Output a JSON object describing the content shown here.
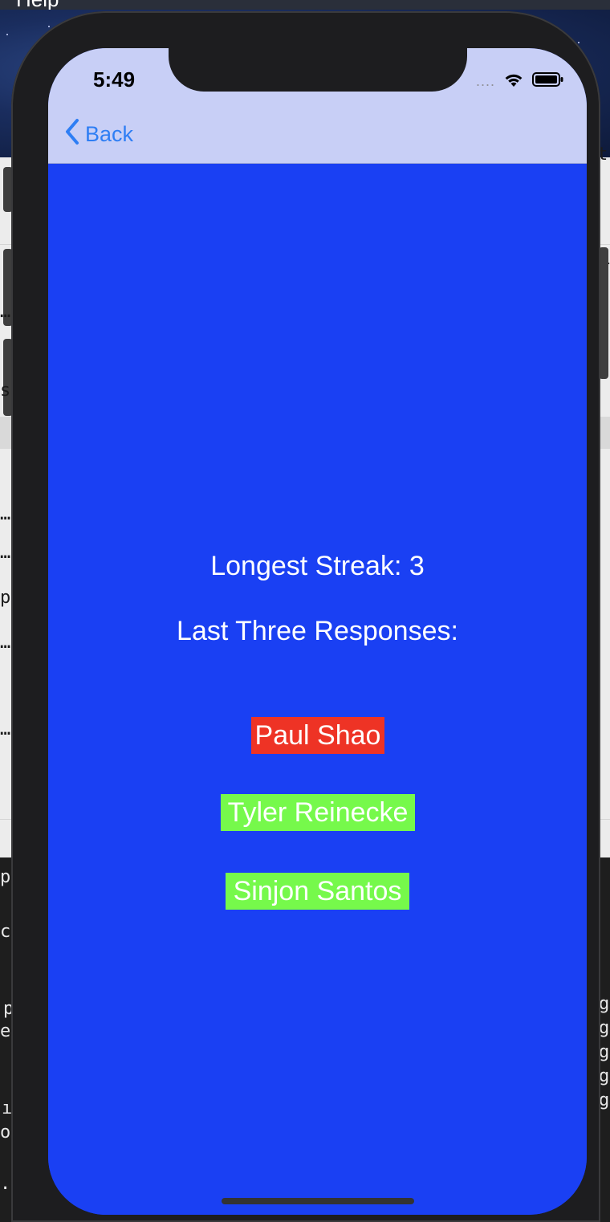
{
  "desktop": {
    "menu_label": "Help",
    "fragments": [
      "t",
      "l",
      "s",
      "…",
      "…",
      "…",
      "p",
      "…",
      "…",
      "pe",
      "ce",
      "p",
      "en",
      "g",
      "g",
      "g",
      "g",
      "g",
      "ı",
      "oc",
      ".py"
    ]
  },
  "status_bar": {
    "time": "5:49",
    "signal": "....",
    "icons": [
      "wifi-icon",
      "battery-icon"
    ]
  },
  "nav": {
    "back_label": "Back",
    "back_icon": "chevron-left-icon",
    "background": "#c8cff6",
    "tint": "#2e7ef4"
  },
  "main": {
    "background": "#1a40f3",
    "longest_streak": "Longest Streak: 3",
    "last_three_heading": "Last Three Responses:",
    "responses": [
      {
        "name": "Paul Shao",
        "status": "incorrect",
        "color": "#ee3325"
      },
      {
        "name": "Tyler Reinecke",
        "status": "correct",
        "color": "#76f94b"
      },
      {
        "name": "Sinjon Santos",
        "status": "correct",
        "color": "#76f94b"
      }
    ]
  }
}
